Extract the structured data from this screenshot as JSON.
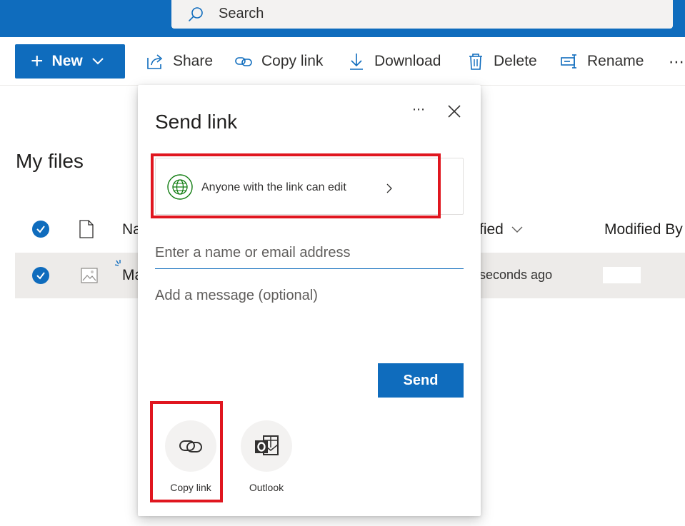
{
  "search": {
    "placeholder": "Search"
  },
  "toolbar": {
    "new_label": "New",
    "share_label": "Share",
    "copy_link_label": "Copy link",
    "download_label": "Download",
    "delete_label": "Delete",
    "rename_label": "Rename",
    "more_label": "⋯"
  },
  "page": {
    "title": "My files"
  },
  "file_list": {
    "columns": {
      "name": "Na",
      "modified": "fied",
      "modified_by": "Modified By"
    },
    "rows": [
      {
        "name": "Ma",
        "modified": "seconds ago",
        "modified_by": ""
      }
    ]
  },
  "dialog": {
    "title": "Send link",
    "more_label": "⋯",
    "permission_text": "Anyone with the link can edit",
    "name_placeholder": "Enter a name or email address",
    "message_placeholder": "Add a message (optional)",
    "send_label": "Send",
    "options": [
      {
        "label": "Copy link",
        "icon": "link-icon"
      },
      {
        "label": "Outlook",
        "icon": "outlook-icon"
      }
    ]
  },
  "colors": {
    "brand": "#0f6cbd",
    "highlight": "#e0161f",
    "globe": "#107c10"
  }
}
